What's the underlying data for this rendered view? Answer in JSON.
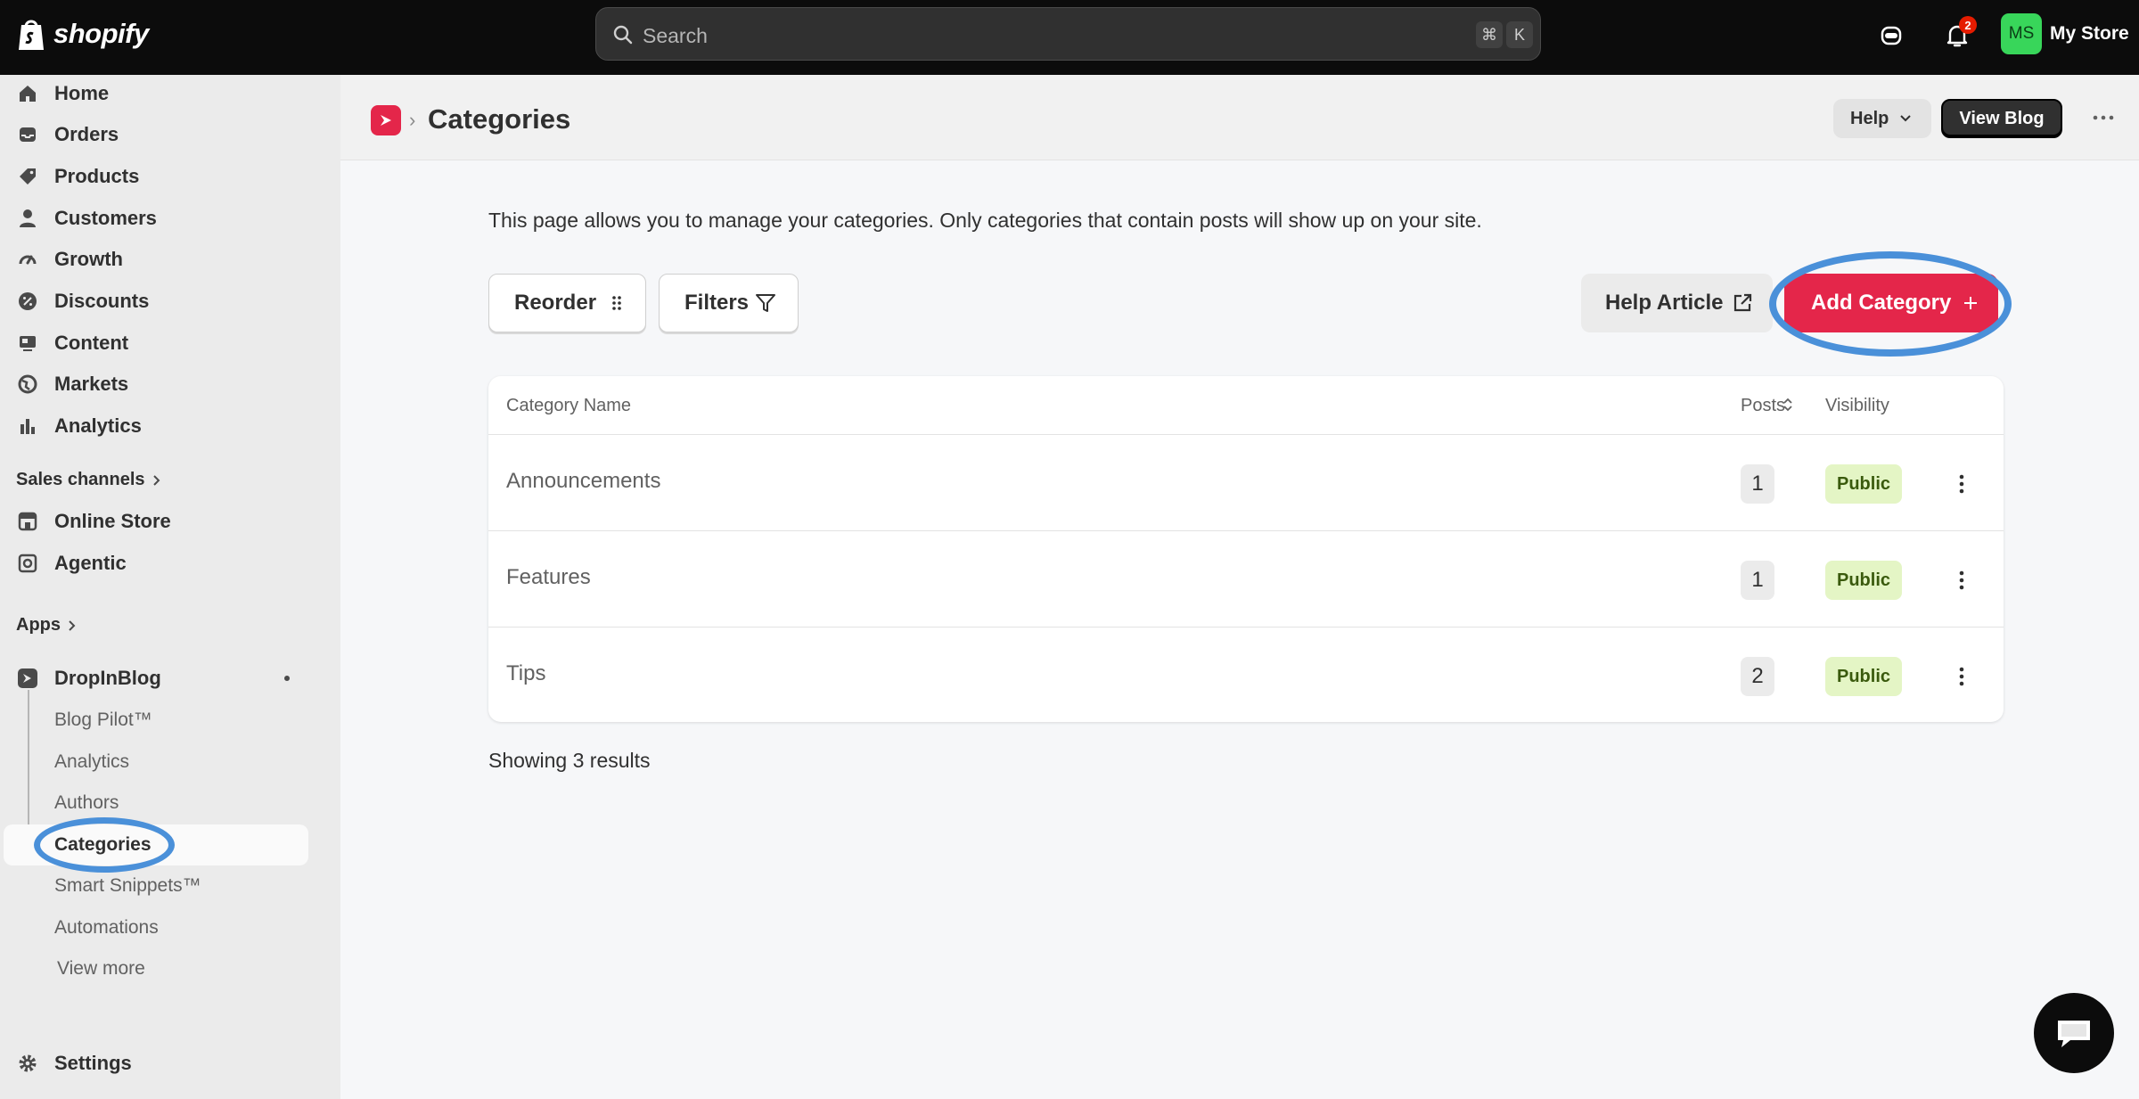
{
  "topbar": {
    "logo_text": "shopify",
    "search_placeholder": "Search",
    "kbd_cmd": "⌘",
    "kbd_key": "K",
    "notification_count": "2",
    "avatar_initials": "MS",
    "store_name": "My Store"
  },
  "sidebar": {
    "items": [
      {
        "label": "Home",
        "icon": "home-icon"
      },
      {
        "label": "Orders",
        "icon": "inbox-icon"
      },
      {
        "label": "Products",
        "icon": "tag-icon"
      },
      {
        "label": "Customers",
        "icon": "person-icon"
      },
      {
        "label": "Growth",
        "icon": "gauge-icon"
      },
      {
        "label": "Discounts",
        "icon": "discount-icon"
      },
      {
        "label": "Content",
        "icon": "content-icon"
      },
      {
        "label": "Markets",
        "icon": "globe-icon"
      },
      {
        "label": "Analytics",
        "icon": "bar-chart-icon"
      }
    ],
    "sales_channels_label": "Sales channels",
    "channels": [
      {
        "label": "Online Store",
        "icon": "store-icon"
      },
      {
        "label": "Agentic",
        "icon": "agentic-icon"
      }
    ],
    "apps_label": "Apps",
    "app": {
      "label": "DropInBlog",
      "icon": "dropinblog-icon"
    },
    "app_subitems": [
      "Blog Pilot™",
      "Analytics",
      "Authors",
      "Categories",
      "Smart Snippets™",
      "Automations"
    ],
    "view_more": "View more",
    "settings_label": "Settings"
  },
  "header": {
    "title": "Categories",
    "help_label": "Help",
    "view_blog_label": "View Blog"
  },
  "main": {
    "intro": "This page allows you to manage your categories. Only categories that contain posts will show up on your site.",
    "reorder_label": "Reorder",
    "filters_label": "Filters",
    "help_article_label": "Help Article",
    "add_category_label": "Add Category",
    "table": {
      "columns": {
        "name": "Category Name",
        "posts": "Posts",
        "visibility": "Visibility"
      },
      "rows": [
        {
          "name": "Announcements",
          "posts": "1",
          "visibility": "Public"
        },
        {
          "name": "Features",
          "posts": "1",
          "visibility": "Public"
        },
        {
          "name": "Tips",
          "posts": "2",
          "visibility": "Public"
        }
      ]
    },
    "results_text": "Showing 3 results"
  },
  "colors": {
    "accent": "#e4264a",
    "highlight_annotation": "#4a90d9",
    "public_badge_bg": "#e4f5c5",
    "topbar_bg": "#0c0c0c"
  }
}
